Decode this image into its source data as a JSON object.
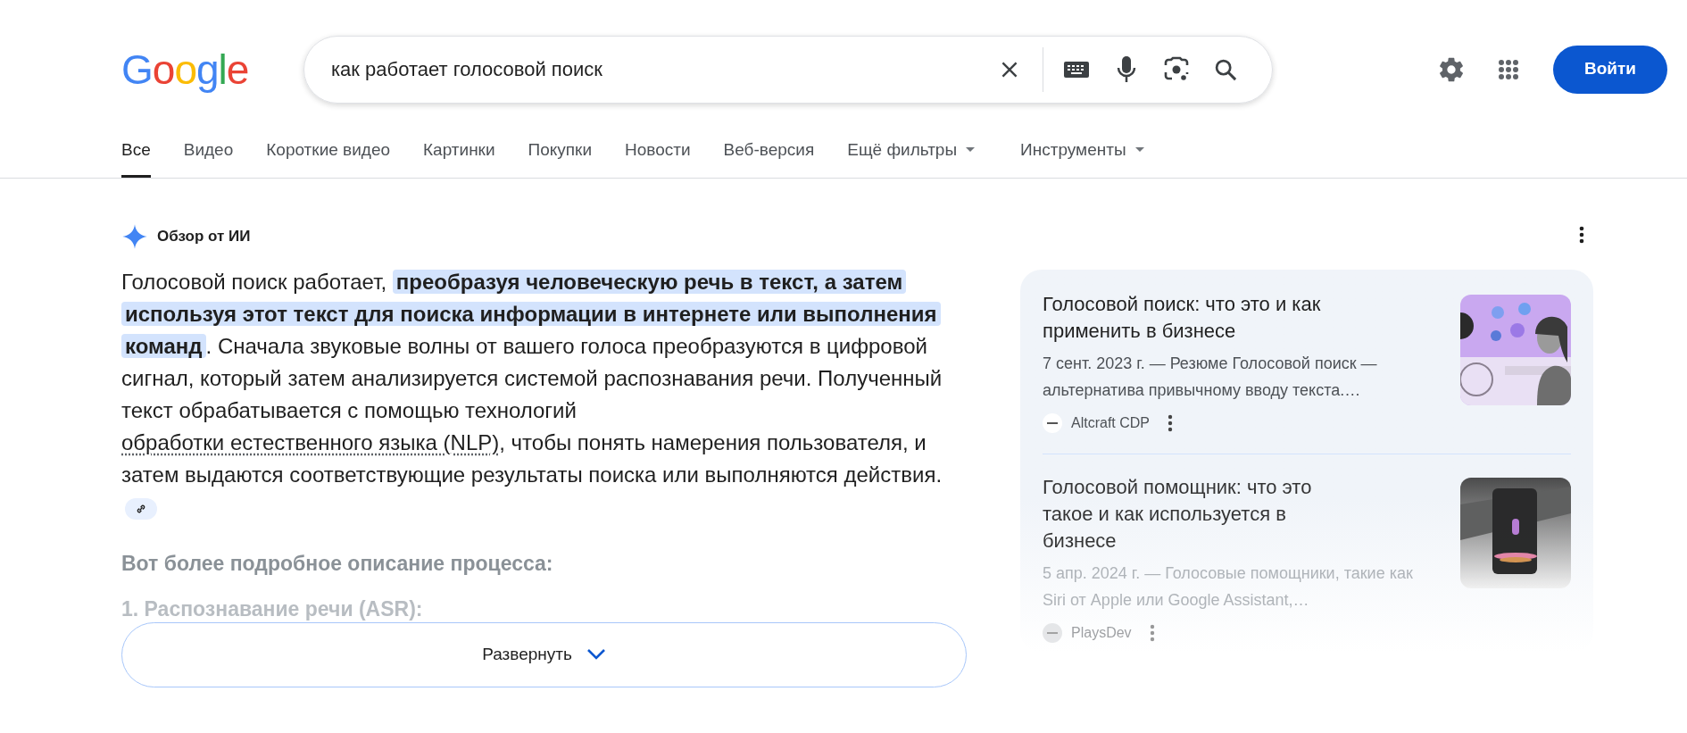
{
  "logo": {
    "text": "Google"
  },
  "search": {
    "value": "как работает голосовой поиск"
  },
  "login_button": "Войти",
  "tabs": [
    {
      "label": "Все",
      "selected": true,
      "kind": "plain"
    },
    {
      "label": "Видео",
      "selected": false,
      "kind": "plain"
    },
    {
      "label": "Короткие видео",
      "selected": false,
      "kind": "plain"
    },
    {
      "label": "Картинки",
      "selected": false,
      "kind": "plain"
    },
    {
      "label": "Покупки",
      "selected": false,
      "kind": "plain"
    },
    {
      "label": "Новости",
      "selected": false,
      "kind": "plain"
    },
    {
      "label": "Веб-версия",
      "selected": false,
      "kind": "plain"
    },
    {
      "label": "Ещё фильтры",
      "selected": false,
      "kind": "dropdown"
    },
    {
      "label": "Инструменты",
      "selected": false,
      "kind": "dropdown"
    }
  ],
  "ai_overview": {
    "title": "Обзор от ИИ",
    "paragraph": [
      {
        "kind": "text",
        "text": "Голосовой поиск работает, "
      },
      {
        "kind": "highlight",
        "text": "преобразуя человеческую речь в текст, а затем используя этот текст для поиска информации в интернете или выполнения команд"
      },
      {
        "kind": "text",
        "text": ". Сначала звуковые волны от вашего голоса преобразуются в цифровой сигнал, который затем анализируется системой распознавания речи. Полученный текст обрабатывается с помощью технологий "
      },
      {
        "kind": "link",
        "text": "обработки естественного языка (NLP)"
      },
      {
        "kind": "text",
        "text": ", чтобы понять намерения пользователя, и затем выдаются соответствующие результаты поиска или выполняются действия."
      }
    ],
    "subheading": "Вот более подробное описание процесса:",
    "faded_item": "1. Распознавание речи (ASR):",
    "expand_button": "Развернуть",
    "sources": [
      {
        "title": "Голосовой поиск: что это и как применить в бизнесе",
        "snippet": "7 сент. 2023 г. — Резюме Голосовой поиск — альтернатива привычному вводу текста.…",
        "site": "Altcraft CDP",
        "faded": false,
        "kind": "picture"
      },
      {
        "title": "Голосовой помощник: что это такое и как используется в бизнесе",
        "snippet": "5 апр. 2024 г. — Голосовые помощники, такие как Siri от Apple или Google Assistant,…",
        "site": "PlaysDev",
        "faded": true,
        "kind": "picture"
      }
    ]
  }
}
